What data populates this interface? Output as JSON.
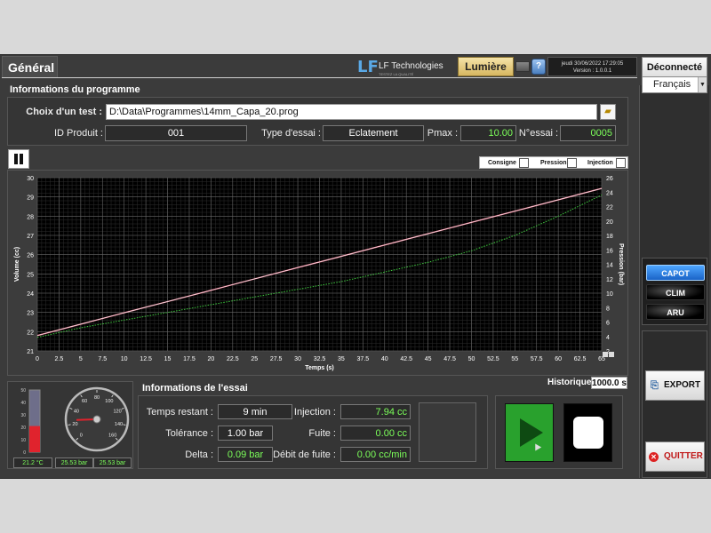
{
  "header": {
    "tab_label": "Général",
    "logo_mark": "LF",
    "logo_name": "LF Technologies",
    "logo_tagline": "TESTEZ LA QUALITÉ",
    "lumiere_label": "Lumière",
    "info_symbol": "?",
    "date_line": "jeudi 30/06/2022 17:29:05",
    "version_line": "Version : 1.0.0.1",
    "deconnect_label": "Déconnecté",
    "language": "Français"
  },
  "programme": {
    "title": "Informations du programme",
    "test_label": "Choix d'un test :",
    "test_path": "D:\\Data\\Programmes\\14mm_Capa_20.prog",
    "id_label": "ID Produit :",
    "id_value": "001",
    "type_label": "Type d'essai :",
    "type_value": "Eclatement",
    "pmax_label": "Pmax :",
    "pmax_value": "10.00",
    "nessai_label": "N°essai :",
    "nessai_value": "0005"
  },
  "legend": {
    "consigne": "Consigne",
    "pression": "Pression",
    "injection": "Injection"
  },
  "colors": {
    "pression": "#ff6e8c",
    "consigne": "#e8e8e8",
    "injection": "#3cc83c",
    "accent_green": "#7cff5a"
  },
  "chart_data": {
    "type": "line",
    "xlabel": "Temps (s)",
    "ylabel": "Volume (cc)",
    "y2label": "Pression (bar)",
    "xlim": [
      0,
      65
    ],
    "ylim": [
      21,
      30
    ],
    "y2lim": [
      2,
      26
    ],
    "x_ticks": [
      "0",
      "2.5",
      "5",
      "7.5",
      "10",
      "12.5",
      "15",
      "17.5",
      "20",
      "22.5",
      "25",
      "27.5",
      "30",
      "32.5",
      "35",
      "37.5",
      "40",
      "42.5",
      "45",
      "47.5",
      "50",
      "52.5",
      "55",
      "57.5",
      "60",
      "62.5",
      "65"
    ],
    "y_ticks": [
      "21",
      "22",
      "23",
      "24",
      "25",
      "26",
      "27",
      "28",
      "29",
      "30"
    ],
    "y2_ticks": [
      "2",
      "4",
      "6",
      "8",
      "10",
      "12",
      "14",
      "16",
      "18",
      "20",
      "22",
      "24",
      "26"
    ],
    "grid": true,
    "series": [
      {
        "name": "Pression",
        "axis": "y",
        "x": [
          0,
          5,
          10,
          15,
          20,
          25,
          30,
          35,
          40,
          45,
          50,
          55,
          60,
          65
        ],
        "values": [
          21.8,
          22.39,
          22.98,
          23.56,
          24.15,
          24.74,
          25.33,
          25.91,
          26.5,
          27.09,
          27.68,
          28.26,
          28.85,
          29.44
        ]
      },
      {
        "name": "Consigne",
        "axis": "y",
        "x": [
          0,
          5,
          10,
          15,
          20,
          25,
          30,
          35,
          40,
          45,
          50,
          55,
          60,
          65
        ],
        "values": [
          21.8,
          22.39,
          22.98,
          23.56,
          24.15,
          24.74,
          25.33,
          25.91,
          26.5,
          27.09,
          27.68,
          28.26,
          28.85,
          29.44
        ]
      },
      {
        "name": "Injection",
        "axis": "y",
        "x": [
          0,
          5,
          10,
          15,
          20,
          25,
          30,
          35,
          40,
          45,
          50,
          55,
          60,
          65
        ],
        "values": [
          21.7,
          22.2,
          22.6,
          23.0,
          23.4,
          23.8,
          24.2,
          24.6,
          25.1,
          25.6,
          26.2,
          27.0,
          28.0,
          29.1
        ]
      }
    ]
  },
  "gauges": {
    "temperature": "21.2 °C",
    "thermo_ticks": [
      "50",
      "40",
      "30",
      "20",
      "10",
      "0"
    ],
    "thermo_level": 0.42,
    "pressure_1": "25.53 bar",
    "pressure_2": "25.53 bar",
    "dial_ticks": [
      "0",
      "20",
      "40",
      "60",
      "80",
      "100",
      "120",
      "140",
      "160"
    ],
    "dial_value": 25.53
  },
  "essai": {
    "title": "Informations de l'essai",
    "temps_label": "Temps restant :",
    "temps_value": "9 min",
    "tol_label": "Tolérance :",
    "tol_value": "1.00 bar",
    "delta_label": "Delta :",
    "delta_value": "0.09 bar",
    "inj_label": "Injection :",
    "inj_value": "7.94 cc",
    "fuite_label": "Fuite :",
    "fuite_value": "0.00 cc",
    "debit_label": "Débit de fuite :",
    "debit_value": "0.00 cc/min"
  },
  "historique": {
    "label": "Historique",
    "value": "1000.0 s"
  },
  "side": {
    "capot": "CAPOT",
    "clim": "CLIM",
    "aru": "ARU",
    "export": "EXPORT",
    "quitter": "QUITTER"
  }
}
